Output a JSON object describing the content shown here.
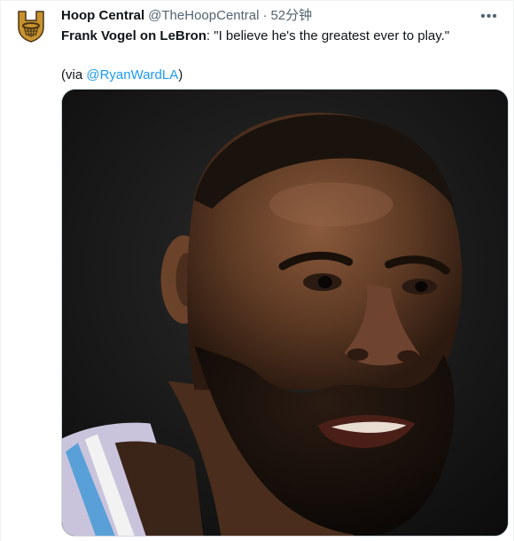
{
  "tweet": {
    "author": {
      "display_name": "Hoop Central",
      "handle": "@TheHoopCentral",
      "separator": "·",
      "time": "52分钟",
      "avatar_icon": "hoop-central-logo-icon"
    },
    "more_icon": "more-horizontal-icon",
    "text": {
      "bold_part": "Frank Vogel on LeBron",
      "quote": ": \"I believe he's the greatest ever to play.\"",
      "via_prefix": "(via ",
      "mention": "@RyanWardLA",
      "via_suffix": ")"
    },
    "media": {
      "kind": "photo"
    }
  },
  "colors": {
    "link": "#1d9bf0",
    "secondary_text": "#536471",
    "primary_text": "#0f1419",
    "logo_gold": "#c8932f",
    "logo_dark": "#4a3415"
  }
}
